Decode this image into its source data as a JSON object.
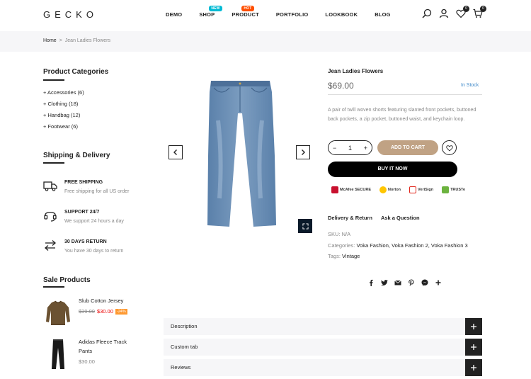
{
  "header": {
    "logo": "GECKO",
    "nav": [
      {
        "label": "DEMO"
      },
      {
        "label": "SHOP",
        "badge": "NEW"
      },
      {
        "label": "PRODUCT",
        "badge": "HOT"
      },
      {
        "label": "PORTFOLIO"
      },
      {
        "label": "LOOKBOOK"
      },
      {
        "label": "BLOG"
      }
    ],
    "wishlist_count": "0",
    "cart_count": "0"
  },
  "breadcrumb": {
    "home": "Home",
    "separator": ">",
    "current": "Jean Ladies Flowers"
  },
  "sidebar": {
    "categories_title": "Product Categories",
    "categories": [
      "+ Accessories (6)",
      "+ Clothing (18)",
      "+ Handbag (12)",
      "+ Footwear (6)"
    ],
    "shipping_title": "Shipping & Delivery",
    "shipping": [
      {
        "title": "FREE SHIPPING",
        "sub": "Free shipping for all US order",
        "icon": "truck-icon"
      },
      {
        "title": "SUPPORT 24/7",
        "sub": "We support 24 hours a day",
        "icon": "headset-icon"
      },
      {
        "title": "30 DAYS RETURN",
        "sub": "You have 30 days to return",
        "icon": "return-arrows-icon"
      }
    ],
    "sale_title": "Sale Products",
    "sale": [
      {
        "name": "Slub Cotton Jersey",
        "old_price": "$39.00",
        "price": "$30.00",
        "off": "-24%"
      },
      {
        "name": "Adidas Fleece Track Pants",
        "price": "$30.00"
      }
    ]
  },
  "product": {
    "title": "Jean Ladies Flowers",
    "price": "$69.00",
    "stock": "In Stock",
    "description": "A pair of twill woven shorts featuring slanted front pockets, buttoned back pockets, a zip pocket, buttoned waist, and keychain loop.",
    "qty": "1",
    "qty_minus": "−",
    "qty_plus": "+",
    "add_to_cart": "ADD TO CART",
    "buy_now": "BUY IT NOW",
    "trust_badges": [
      "McAfee SECURE",
      "Norton",
      "VeriSign",
      "TRUSTe"
    ],
    "links": [
      "Delivery & Return",
      "Ask a Question"
    ],
    "sku_label": "SKU:",
    "sku": "N/A",
    "categories_label": "Categories:",
    "categories": "Voka Fashion, Voka Fashion 2, Voka Fashion 3",
    "tags_label": "Tags:",
    "tags": "Vintage"
  },
  "tabs": [
    {
      "label": "Description"
    },
    {
      "label": "Custom tab"
    },
    {
      "label": "Reviews"
    }
  ],
  "colors": {
    "accent": "#c0a284",
    "stock": "#428bca",
    "sale": "#ec0101",
    "off_badge": "#fe9931",
    "badge_new": "#01bad4",
    "badge_hot": "#ff4e00"
  }
}
